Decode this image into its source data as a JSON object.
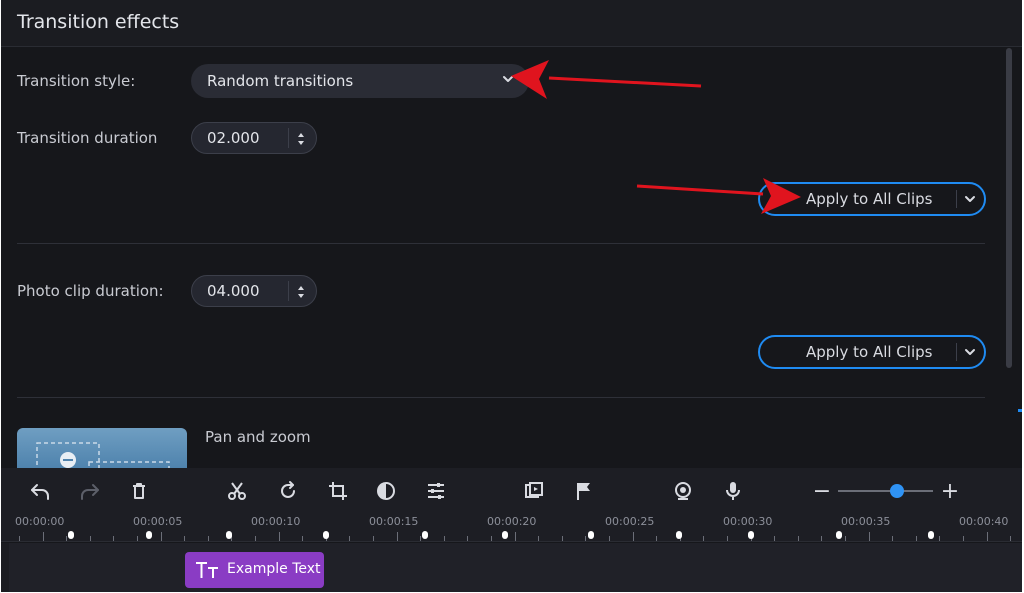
{
  "panel": {
    "title": "Transition effects"
  },
  "transition_style": {
    "label": "Transition style:",
    "value": "Random transitions"
  },
  "transition_duration": {
    "label": "Transition duration",
    "value": "02.000"
  },
  "photo_clip_duration": {
    "label": "Photo clip duration:",
    "value": "04.000"
  },
  "apply_buttons": [
    {
      "label": "Apply to All Clips"
    },
    {
      "label": "Apply to All Clips"
    }
  ],
  "pan_zoom": {
    "label": "Pan and zoom"
  },
  "toolbar": {
    "icons": [
      "undo-icon",
      "redo-icon",
      "delete-icon",
      "cut-icon",
      "rotate-icon",
      "crop-icon",
      "color-adjust-icon",
      "settings-sliders-icon",
      "clip-properties-icon",
      "marker-flag-icon",
      "webcam-icon",
      "microphone-icon",
      "zoom-out-icon",
      "zoom-in-icon"
    ],
    "zoom_out_symbol": "−",
    "zoom_in_symbol": "+"
  },
  "timeline": {
    "ticks": [
      "00:00:00",
      "00:00:05",
      "00:00:10",
      "00:00:15",
      "00:00:20",
      "00:00:25",
      "00:00:30",
      "00:00:35",
      "00:00:40"
    ]
  },
  "text_clip": {
    "label": "Example Text"
  },
  "colors": {
    "accent": "#1f8bf2",
    "annotation_arrow": "#e0141e",
    "text_clip": "#8a3cc4",
    "background": "#16171b"
  }
}
